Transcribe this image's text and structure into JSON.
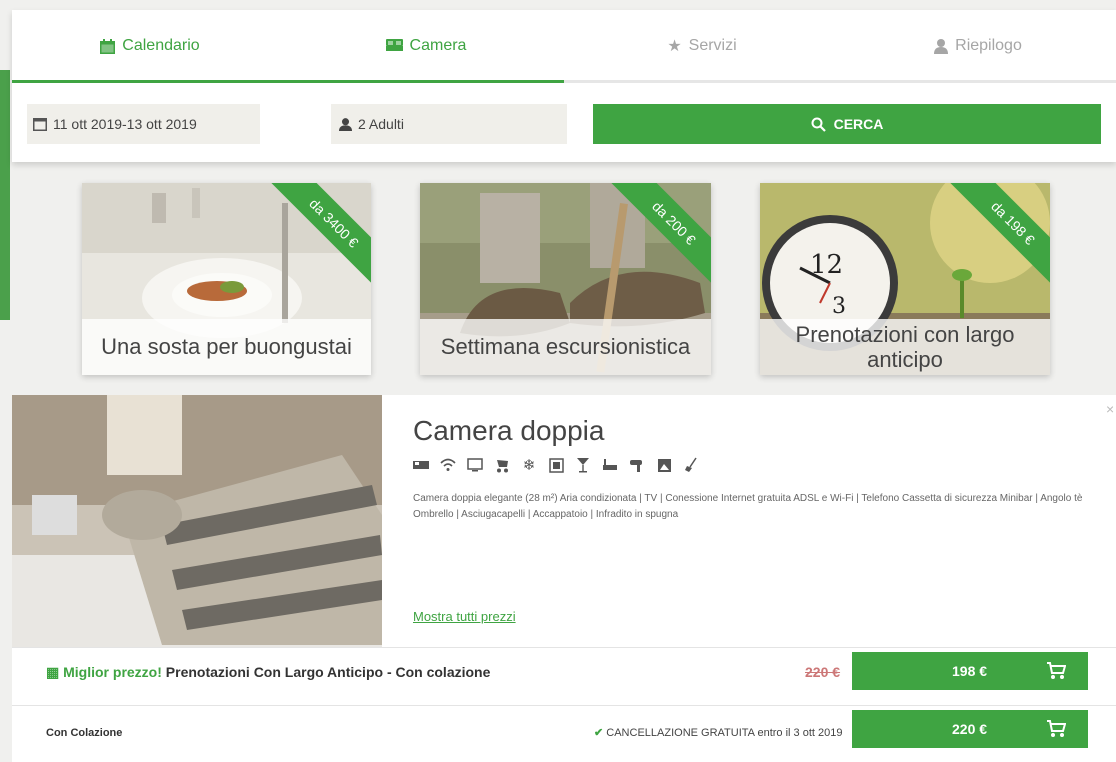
{
  "tabs": [
    {
      "label": "Calendario",
      "icon": "calendar-icon"
    },
    {
      "label": "Camera",
      "icon": "bed-icon"
    },
    {
      "label": "Servizi",
      "icon": "star-icon"
    },
    {
      "label": "Riepilogo",
      "icon": "user-icon"
    }
  ],
  "progress_fraction": 0.5,
  "search": {
    "date_range": "11 ott 2019-13 ott 2019",
    "guests": "2 Adulti",
    "button_label": "CERCA"
  },
  "offers": [
    {
      "ribbon": "da 3400 €",
      "title": "Una sosta per buongustai"
    },
    {
      "ribbon": "da 200 €",
      "title": "Settimana escursionistica"
    },
    {
      "ribbon": "da 198 €",
      "title": "Prenotazioni con largo anticipo"
    }
  ],
  "room": {
    "title": "Camera doppia",
    "amenity_icons": [
      "bed-icon",
      "wifi-icon",
      "tv-icon",
      "stroller-icon",
      "snowflake-icon",
      "safe-icon",
      "cocktail-icon",
      "bathtub-icon",
      "hairdryer-icon",
      "picture-icon",
      "broom-icon"
    ],
    "description": "Camera doppia elegante (28 m²) Aria condizionata | TV | Conessione Internet gratuita ADSL e Wi-Fi | Telefono Cassetta di sicurezza Minibar | Angolo tè Ombrello | Asciugacapelli | Accappatoio | Infradito in spugna",
    "show_all_prices": "Mostra tutti prezzi",
    "close": "×"
  },
  "rates": [
    {
      "badge": "Miglior prezzo!",
      "name": "Prenotazioni Con Largo Anticipo -  Con colazione",
      "old_price": "220 €",
      "price": "198 €"
    },
    {
      "name": "Con Colazione",
      "cancellation": "CANCELLAZIONE GRATUITA entro il 3 ott 2019",
      "price": "220 €"
    }
  ],
  "colors": {
    "accent": "#3fa442",
    "background": "#f0f0ee"
  }
}
